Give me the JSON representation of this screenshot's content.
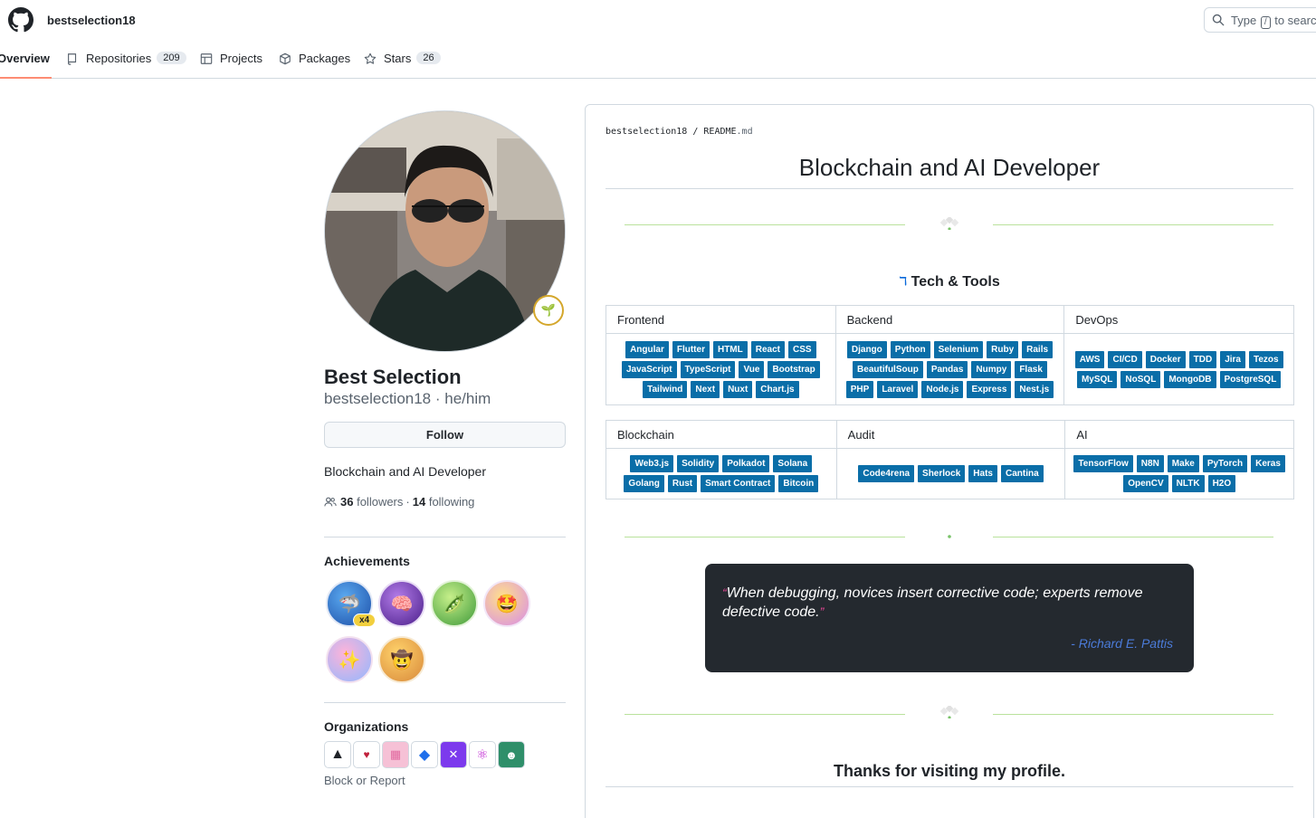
{
  "header": {
    "username": "bestselection18",
    "search": {
      "prefix": "Type",
      "key": "/",
      "suffix": "to search"
    }
  },
  "tabs": [
    {
      "label": "Overview",
      "count": ""
    },
    {
      "label": "Repositories",
      "count": "209"
    },
    {
      "label": "Projects",
      "count": ""
    },
    {
      "label": "Packages",
      "count": ""
    },
    {
      "label": "Stars",
      "count": "26"
    }
  ],
  "profile": {
    "name": "Best Selection",
    "login_line": "bestselection18 · he/him",
    "follow_label": "Follow",
    "bio": "Blockchain and AI Developer",
    "followers_count": "36",
    "followers_label": "followers",
    "sep": "·",
    "following_count": "14",
    "following_label": "following"
  },
  "achievements": {
    "title": "Achievements",
    "multiplier": "x4",
    "items": [
      "pull-shark",
      "galaxy-brain",
      "pair-extraordinaire",
      "starstruck",
      "yolo",
      "quickdraw"
    ]
  },
  "organizations": {
    "title": "Organizations",
    "block_label": "Block or Report"
  },
  "readme": {
    "owner": "bestselection18",
    "slash": "/",
    "file": "README",
    "ext": ".md",
    "heading": "Blockchain and AI Developer",
    "tools_glyph": "ℸ",
    "tools_heading": "Tech & Tools",
    "table1": {
      "headers": [
        "Frontend",
        "Backend",
        "DevOps"
      ],
      "cells": [
        [
          "Angular",
          "Flutter",
          "HTML",
          "React",
          "CSS",
          "JavaScript",
          "TypeScript",
          "Vue",
          "Bootstrap",
          "Tailwind",
          "Next",
          "Nuxt",
          "Chart.js"
        ],
        [
          "Django",
          "Python",
          "Selenium",
          "Ruby",
          "Rails",
          "BeautifulSoup",
          "Pandas",
          "Numpy",
          "Flask",
          "PHP",
          "Laravel",
          "Node.js",
          "Express",
          "Nest.js"
        ],
        [
          "AWS",
          "CI/CD",
          "Docker",
          "TDD",
          "Jira",
          "Tezos",
          "MySQL",
          "NoSQL",
          "MongoDB",
          "PostgreSQL"
        ]
      ]
    },
    "table2": {
      "headers": [
        "Blockchain",
        "Audit",
        "AI"
      ],
      "cells": [
        [
          "Web3.js",
          "Solidity",
          "Polkadot",
          "Solana",
          "Golang",
          "Rust",
          "Smart Contract",
          "Bitcoin"
        ],
        [
          "Code4rena",
          "Sherlock",
          "Hats",
          "Cantina"
        ],
        [
          "TensorFlow",
          "N8N",
          "Make",
          "PyTorch",
          "Keras",
          "OpenCV",
          "NLTK",
          "H2O"
        ]
      ]
    },
    "quote": {
      "open": "“",
      "text": "When debugging, novices insert corrective code; experts remove defective code.",
      "close": "”",
      "author": "- Richard E. Pattis"
    },
    "thanks": "Thanks for visiting my profile."
  },
  "colors": {
    "chip": "#0a6ea8",
    "tab_underline": "#fd8c73",
    "quote_bg": "#24292f",
    "divider_green": "#b9e29c"
  }
}
